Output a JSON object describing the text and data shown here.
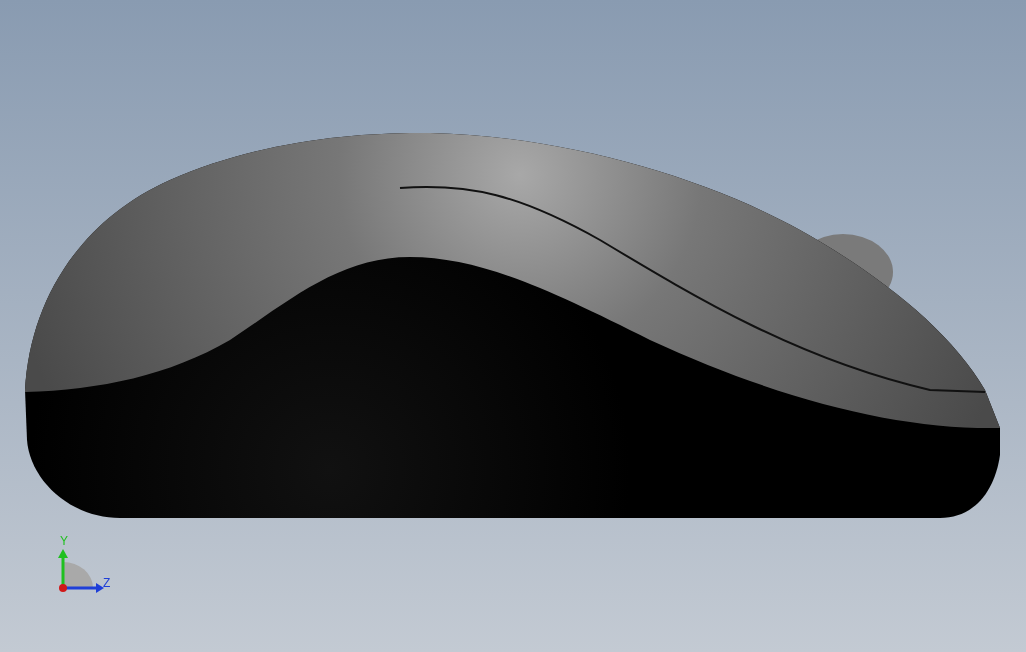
{
  "viewport": {
    "axes": [
      {
        "kind": "y",
        "label": "Y"
      },
      {
        "kind": "z",
        "label": "Z"
      }
    ]
  }
}
